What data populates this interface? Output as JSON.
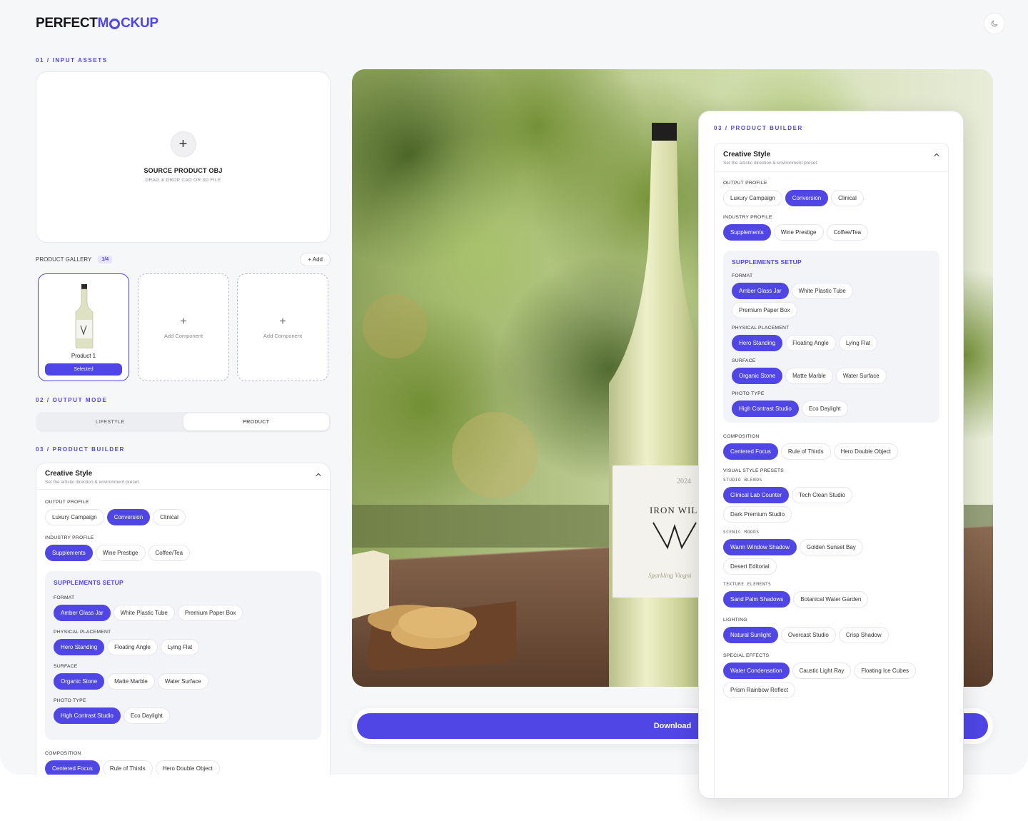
{
  "brand": {
    "part1": "PERFECT ",
    "part2_a": "M",
    "part2_b": "CKUP"
  },
  "sections": {
    "input": "01 / INPUT ASSETS",
    "output": "02 / OUTPUT MODE",
    "builder": "03 / PRODUCT BUILDER"
  },
  "drop": {
    "title": "SOURCE PRODUCT OBJ",
    "sub": "DRAG & DROP CAD OR 3D FILE"
  },
  "gallery": {
    "label": "PRODUCT GALLERY",
    "count": "1/4",
    "add": "+ Add",
    "product_label": "Product 1",
    "selected": "Selected",
    "add_component": "Add Component"
  },
  "mode": {
    "lifestyle": "LIFESTYLE",
    "product": "PRODUCT"
  },
  "creative": {
    "title": "Creative Style",
    "sub": "Set the artistic direction & environment preset."
  },
  "output_profile": {
    "label": "OUTPUT PROFILE",
    "options": [
      "Luxury Campaign",
      "Conversion",
      "Clinical"
    ]
  },
  "industry_profile": {
    "label": "INDUSTRY PROFILE",
    "options": [
      "Supplements",
      "Wine Prestige",
      "Coffee/Tea"
    ]
  },
  "setup": {
    "title": "SUPPLEMENTS SETUP",
    "format": {
      "label": "FORMAT",
      "options": [
        "Amber Glass Jar",
        "White Plastic Tube",
        "Premium Paper Box"
      ]
    },
    "placement": {
      "label": "PHYSICAL PLACEMENT",
      "options": [
        "Hero Standing",
        "Floating Angle",
        "Lying Flat"
      ]
    },
    "surface": {
      "label": "SURFACE",
      "options": [
        "Organic Stone",
        "Matte Marble",
        "Water Surface"
      ]
    },
    "photo": {
      "label": "PHOTO TYPE",
      "options": [
        "High Contrast Studio",
        "Eco Daylight"
      ]
    }
  },
  "composition": {
    "label": "COMPOSITION",
    "options": [
      "Centered Focus",
      "Rule of Thirds",
      "Hero Double Object"
    ]
  },
  "visual": {
    "label": "VISUAL STYLE PRESETS",
    "studio": {
      "label": "STUDIO BLENDS",
      "options": [
        "Clinical Lab Counter",
        "Tech Clean Studio",
        "Dark Premium Studio"
      ]
    },
    "scenic": {
      "label": "SCENIC MOODS",
      "options": [
        "Warm Window Shadow",
        "Golden Sunset Bay",
        "Desert Editorial"
      ]
    },
    "texture": {
      "label": "TEXTURE ELEMENTS",
      "options": [
        "Sand Palm Shadows",
        "Botanical Water Garden"
      ]
    }
  },
  "lighting": {
    "label": "LIGHTING",
    "options": [
      "Natural Sunlight",
      "Overcast Studio",
      "Crisp Shadow"
    ]
  },
  "effects": {
    "label": "SPECIAL EFFECTS",
    "options": [
      "Water Condensation",
      "Caustic Light Ray",
      "Floating Ice Cubes",
      "Prism Rainbow Reflect"
    ]
  },
  "label_art": {
    "year": "2024",
    "brand": "IRON WIL",
    "sub": "Sparkling Viogni"
  },
  "download": "Download",
  "colors": {
    "accent": "#4f46e5"
  }
}
